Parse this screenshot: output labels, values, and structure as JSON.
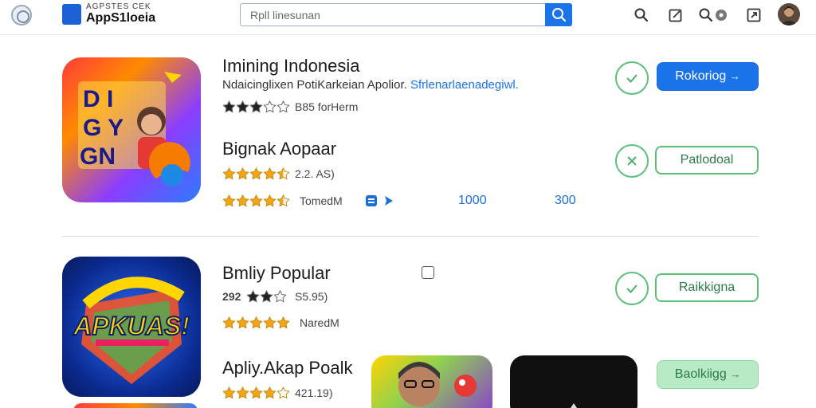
{
  "header": {
    "brand_small": "AGPSTES CEK",
    "brand_name": "AppS1loeia",
    "search": {
      "value": "",
      "placeholder": "Rpll linesunan"
    }
  },
  "apps": [
    {
      "title": "Imining Indonesia",
      "description_text": "Ndaicinglixen PotiKarkeian Apolior.",
      "description_link": "Sfrlenarlaenadegiwl.",
      "rating_text": "B85 forHerm",
      "rating_stars": 3,
      "action_label": "Rokoriog"
    },
    {
      "title": "Bignak Aopaar",
      "rating_a_text": "2.2. AS)",
      "rating_a_stars": 4.5,
      "rating_b_text": "TomedM",
      "rating_b_stars": 4.5,
      "count_1": "1000",
      "count_2": "300",
      "action_label": "Patlodoal"
    },
    {
      "title": "Bmliy Popular",
      "rating_a_text": "S5.95)",
      "rating_a_prefix": "292",
      "rating_a_stars": 2,
      "rating_b_text": "NaredM",
      "rating_b_stars": 5,
      "action_label": "Raikkigna"
    },
    {
      "title": "Apliy.Akap Poalk",
      "rating_text": "421.19)",
      "rating_stars": 4,
      "action_label": "Baolkiigg"
    }
  ],
  "icons": {
    "app1": "letters-game-icon",
    "app2": "apkuas-logo-icon",
    "app3": "man-portrait-icon",
    "app4": "dark-app-icon"
  },
  "colors": {
    "accent_blue": "#1a73e8",
    "accent_green": "#5cbf7a",
    "star_dark": "#222222",
    "star_gold": "#f2a515"
  }
}
